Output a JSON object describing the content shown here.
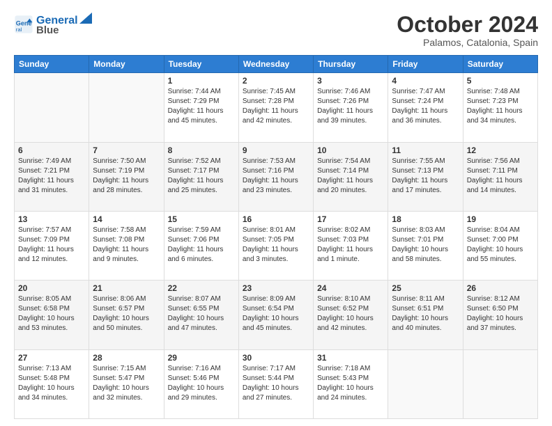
{
  "logo": {
    "line1": "General",
    "line2": "Blue"
  },
  "title": "October 2024",
  "subtitle": "Palamos, Catalonia, Spain",
  "headers": [
    "Sunday",
    "Monday",
    "Tuesday",
    "Wednesday",
    "Thursday",
    "Friday",
    "Saturday"
  ],
  "rows": [
    [
      {
        "day": "",
        "info": ""
      },
      {
        "day": "",
        "info": ""
      },
      {
        "day": "1",
        "info": "Sunrise: 7:44 AM\nSunset: 7:29 PM\nDaylight: 11 hours and 45 minutes."
      },
      {
        "day": "2",
        "info": "Sunrise: 7:45 AM\nSunset: 7:28 PM\nDaylight: 11 hours and 42 minutes."
      },
      {
        "day": "3",
        "info": "Sunrise: 7:46 AM\nSunset: 7:26 PM\nDaylight: 11 hours and 39 minutes."
      },
      {
        "day": "4",
        "info": "Sunrise: 7:47 AM\nSunset: 7:24 PM\nDaylight: 11 hours and 36 minutes."
      },
      {
        "day": "5",
        "info": "Sunrise: 7:48 AM\nSunset: 7:23 PM\nDaylight: 11 hours and 34 minutes."
      }
    ],
    [
      {
        "day": "6",
        "info": "Sunrise: 7:49 AM\nSunset: 7:21 PM\nDaylight: 11 hours and 31 minutes."
      },
      {
        "day": "7",
        "info": "Sunrise: 7:50 AM\nSunset: 7:19 PM\nDaylight: 11 hours and 28 minutes."
      },
      {
        "day": "8",
        "info": "Sunrise: 7:52 AM\nSunset: 7:17 PM\nDaylight: 11 hours and 25 minutes."
      },
      {
        "day": "9",
        "info": "Sunrise: 7:53 AM\nSunset: 7:16 PM\nDaylight: 11 hours and 23 minutes."
      },
      {
        "day": "10",
        "info": "Sunrise: 7:54 AM\nSunset: 7:14 PM\nDaylight: 11 hours and 20 minutes."
      },
      {
        "day": "11",
        "info": "Sunrise: 7:55 AM\nSunset: 7:13 PM\nDaylight: 11 hours and 17 minutes."
      },
      {
        "day": "12",
        "info": "Sunrise: 7:56 AM\nSunset: 7:11 PM\nDaylight: 11 hours and 14 minutes."
      }
    ],
    [
      {
        "day": "13",
        "info": "Sunrise: 7:57 AM\nSunset: 7:09 PM\nDaylight: 11 hours and 12 minutes."
      },
      {
        "day": "14",
        "info": "Sunrise: 7:58 AM\nSunset: 7:08 PM\nDaylight: 11 hours and 9 minutes."
      },
      {
        "day": "15",
        "info": "Sunrise: 7:59 AM\nSunset: 7:06 PM\nDaylight: 11 hours and 6 minutes."
      },
      {
        "day": "16",
        "info": "Sunrise: 8:01 AM\nSunset: 7:05 PM\nDaylight: 11 hours and 3 minutes."
      },
      {
        "day": "17",
        "info": "Sunrise: 8:02 AM\nSunset: 7:03 PM\nDaylight: 11 hours and 1 minute."
      },
      {
        "day": "18",
        "info": "Sunrise: 8:03 AM\nSunset: 7:01 PM\nDaylight: 10 hours and 58 minutes."
      },
      {
        "day": "19",
        "info": "Sunrise: 8:04 AM\nSunset: 7:00 PM\nDaylight: 10 hours and 55 minutes."
      }
    ],
    [
      {
        "day": "20",
        "info": "Sunrise: 8:05 AM\nSunset: 6:58 PM\nDaylight: 10 hours and 53 minutes."
      },
      {
        "day": "21",
        "info": "Sunrise: 8:06 AM\nSunset: 6:57 PM\nDaylight: 10 hours and 50 minutes."
      },
      {
        "day": "22",
        "info": "Sunrise: 8:07 AM\nSunset: 6:55 PM\nDaylight: 10 hours and 47 minutes."
      },
      {
        "day": "23",
        "info": "Sunrise: 8:09 AM\nSunset: 6:54 PM\nDaylight: 10 hours and 45 minutes."
      },
      {
        "day": "24",
        "info": "Sunrise: 8:10 AM\nSunset: 6:52 PM\nDaylight: 10 hours and 42 minutes."
      },
      {
        "day": "25",
        "info": "Sunrise: 8:11 AM\nSunset: 6:51 PM\nDaylight: 10 hours and 40 minutes."
      },
      {
        "day": "26",
        "info": "Sunrise: 8:12 AM\nSunset: 6:50 PM\nDaylight: 10 hours and 37 minutes."
      }
    ],
    [
      {
        "day": "27",
        "info": "Sunrise: 7:13 AM\nSunset: 5:48 PM\nDaylight: 10 hours and 34 minutes."
      },
      {
        "day": "28",
        "info": "Sunrise: 7:15 AM\nSunset: 5:47 PM\nDaylight: 10 hours and 32 minutes."
      },
      {
        "day": "29",
        "info": "Sunrise: 7:16 AM\nSunset: 5:46 PM\nDaylight: 10 hours and 29 minutes."
      },
      {
        "day": "30",
        "info": "Sunrise: 7:17 AM\nSunset: 5:44 PM\nDaylight: 10 hours and 27 minutes."
      },
      {
        "day": "31",
        "info": "Sunrise: 7:18 AM\nSunset: 5:43 PM\nDaylight: 10 hours and 24 minutes."
      },
      {
        "day": "",
        "info": ""
      },
      {
        "day": "",
        "info": ""
      }
    ]
  ]
}
